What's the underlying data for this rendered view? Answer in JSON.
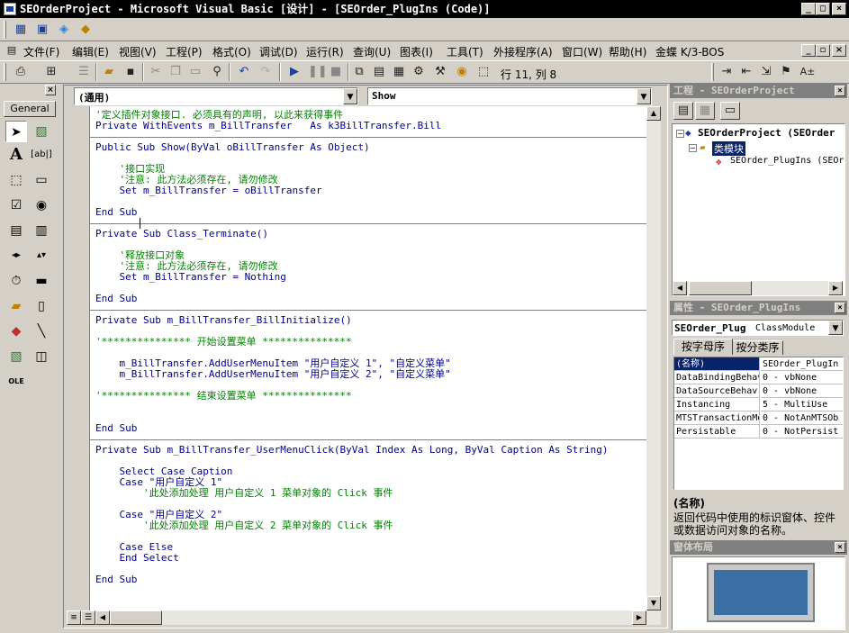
{
  "window": {
    "title": "SEOrderProject - Microsoft Visual Basic [设计] - [SEOrder_PlugIns (Code)]"
  },
  "menu": [
    "文件(F)",
    "编辑(E)",
    "视图(V)",
    "工程(P)",
    "格式(O)",
    "调试(D)",
    "运行(R)",
    "查询(U)",
    "图表(I)",
    "工具(T)",
    "外接程序(A)",
    "窗口(W)",
    "帮助(H)",
    "金蝶 K/3-BOS"
  ],
  "toolbar": {
    "position": "行 11, 列 8"
  },
  "toolbox": {
    "tab": "General"
  },
  "code_window": {
    "object_combo": "(通用)",
    "proc_combo": "Show",
    "lines": [
      {
        "t": "'定义插件对象接口. 必须具有的声明, 以此来获得事件",
        "c": "cm"
      },
      {
        "t": "Private WithEvents m_BillTransfer   As k3BillTransfer.Bill",
        "c": "kw"
      },
      {
        "t": "",
        "c": "",
        "sep": true
      },
      {
        "t": "Public Sub Show(ByVal oBillTransfer As Object)",
        "c": "kw"
      },
      {
        "t": "",
        "c": ""
      },
      {
        "t": "    '接口实现",
        "c": "cm"
      },
      {
        "t": "    '注意: 此方法必须存在, 请勿修改",
        "c": "cm"
      },
      {
        "t": "    Set m_BillTransfer = oBillTransfer",
        "c": "kw"
      },
      {
        "t": "",
        "c": ""
      },
      {
        "t": "End Sub",
        "c": "kw"
      },
      {
        "t": "",
        "c": "",
        "sep": true
      },
      {
        "t": "Private Sub Class_Terminate()",
        "c": "kw"
      },
      {
        "t": "",
        "c": ""
      },
      {
        "t": "    '释放接口对象",
        "c": "cm"
      },
      {
        "t": "    '注意: 此方法必须存在, 请勿修改",
        "c": "cm"
      },
      {
        "t": "    Set m_BillTransfer = Nothing",
        "c": "kw"
      },
      {
        "t": "",
        "c": ""
      },
      {
        "t": "End Sub",
        "c": "kw"
      },
      {
        "t": "",
        "c": "",
        "sep": true
      },
      {
        "t": "Private Sub m_BillTransfer_BillInitialize()",
        "c": "kw"
      },
      {
        "t": "",
        "c": ""
      },
      {
        "t": "'*************** 开始设置菜单 ***************",
        "c": "cm"
      },
      {
        "t": "",
        "c": ""
      },
      {
        "t": "    m_BillTransfer.AddUserMenuItem \"用户自定义 1\", \"自定义菜单\"",
        "c": "kw"
      },
      {
        "t": "    m_BillTransfer.AddUserMenuItem \"用户自定义 2\", \"自定义菜单\"",
        "c": "kw"
      },
      {
        "t": "",
        "c": ""
      },
      {
        "t": "'*************** 结束设置菜单 ***************",
        "c": "cm"
      },
      {
        "t": "",
        "c": ""
      },
      {
        "t": "",
        "c": ""
      },
      {
        "t": "End Sub",
        "c": "kw"
      },
      {
        "t": "",
        "c": "",
        "sep": true
      },
      {
        "t": "Private Sub m_BillTransfer_UserMenuClick(ByVal Index As Long, ByVal Caption As String)",
        "c": "kw"
      },
      {
        "t": "",
        "c": ""
      },
      {
        "t": "    Select Case Caption",
        "c": "kw"
      },
      {
        "t": "    Case \"用户自定义 1\"",
        "c": "kw"
      },
      {
        "t": "        '此处添加处理 用户自定义 1 菜单对象的 Click 事件",
        "c": "cm"
      },
      {
        "t": "",
        "c": ""
      },
      {
        "t": "    Case \"用户自定义 2\"",
        "c": "kw"
      },
      {
        "t": "        '此处添加处理 用户自定义 2 菜单对象的 Click 事件",
        "c": "cm"
      },
      {
        "t": "",
        "c": ""
      },
      {
        "t": "    Case Else",
        "c": "kw"
      },
      {
        "t": "    End Select",
        "c": "kw"
      },
      {
        "t": "",
        "c": ""
      },
      {
        "t": "End Sub",
        "c": "kw"
      }
    ]
  },
  "project_panel": {
    "title": "工程 - SEOrderProject",
    "root": "SEOrderProject (SEOrder",
    "folder": "类模块",
    "module": "SEOrder_PlugIns (SEOr"
  },
  "properties_panel": {
    "title": "属性 - SEOrder_PlugIns",
    "object_name": "SEOrder_Plug",
    "object_type": "ClassModule",
    "tabs": [
      "按字母序",
      "按分类序"
    ],
    "rows": [
      {
        "name": "(名称)",
        "value": "SEOrder_PlugIn"
      },
      {
        "name": "DataBindingBehav",
        "value": "0 - vbNone"
      },
      {
        "name": "DataSourceBehav",
        "value": "0 - vbNone"
      },
      {
        "name": "Instancing",
        "value": "5 - MultiUse"
      },
      {
        "name": "MTSTransactionMo",
        "value": "0 - NotAnMTSOb"
      },
      {
        "name": "Persistable",
        "value": "0 - NotPersist"
      }
    ],
    "desc_title": "(名称)",
    "desc_text1": "返回代码中使用的标识窗体、控件",
    "desc_text2": "或数据访问对象的名称。"
  },
  "layout_panel": {
    "title": "窗体布局"
  }
}
